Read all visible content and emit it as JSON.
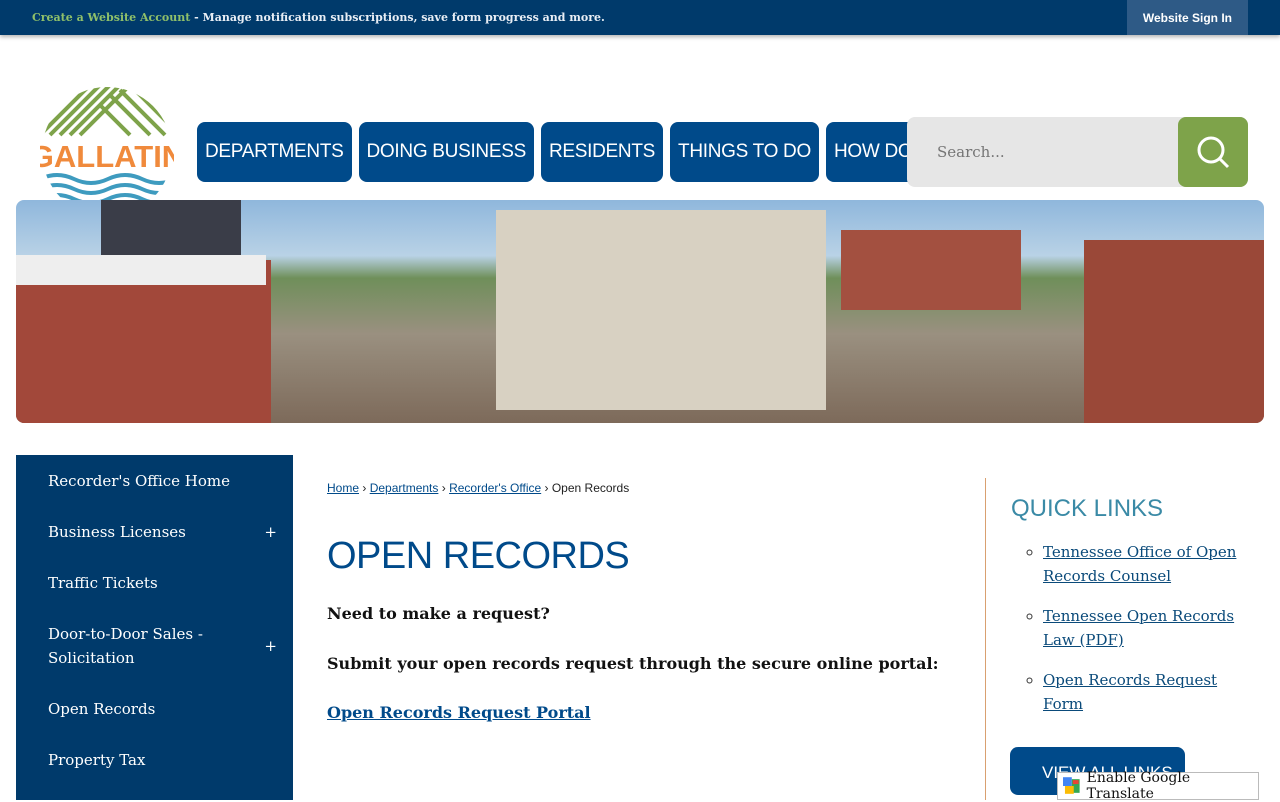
{
  "topbar": {
    "account_link": "Create a Website Account",
    "message": " - Manage notification subscriptions, save form progress and more.",
    "sign_in": "Website Sign In"
  },
  "logo": {
    "text": "GALLATIN"
  },
  "nav": [
    "DEPARTMENTS",
    "DOING BUSINESS",
    "RESIDENTS",
    "THINGS TO DO",
    "HOW DO I..."
  ],
  "search": {
    "placeholder": "Search..."
  },
  "sidebar": [
    {
      "label": "Recorder's Office Home"
    },
    {
      "label": "Business Licenses",
      "expand": "+"
    },
    {
      "label": "Traffic Tickets"
    },
    {
      "label": "Door-to-Door Sales - Solicitation",
      "expand": "+"
    },
    {
      "label": "Open Records"
    },
    {
      "label": "Property Tax"
    }
  ],
  "breadcrumb": {
    "home": "Home",
    "departments": "Departments",
    "office": "Recorder's Office",
    "current": "Open Records",
    "sep": " › "
  },
  "main": {
    "title": "OPEN RECORDS",
    "p1": "Need to make a request?",
    "p2": "Submit your open records request through the secure online portal:",
    "portal_link": "Open Records Request Portal"
  },
  "quick_links": {
    "title": "QUICK LINKS",
    "items": [
      "Tennessee Office of Open Records Counsel",
      "Tennessee Open Records Law (PDF)",
      "Open Records Request Form"
    ],
    "view_all": "VIEW ALL LINKS"
  },
  "translate": {
    "label": "Enable Google Translate"
  }
}
